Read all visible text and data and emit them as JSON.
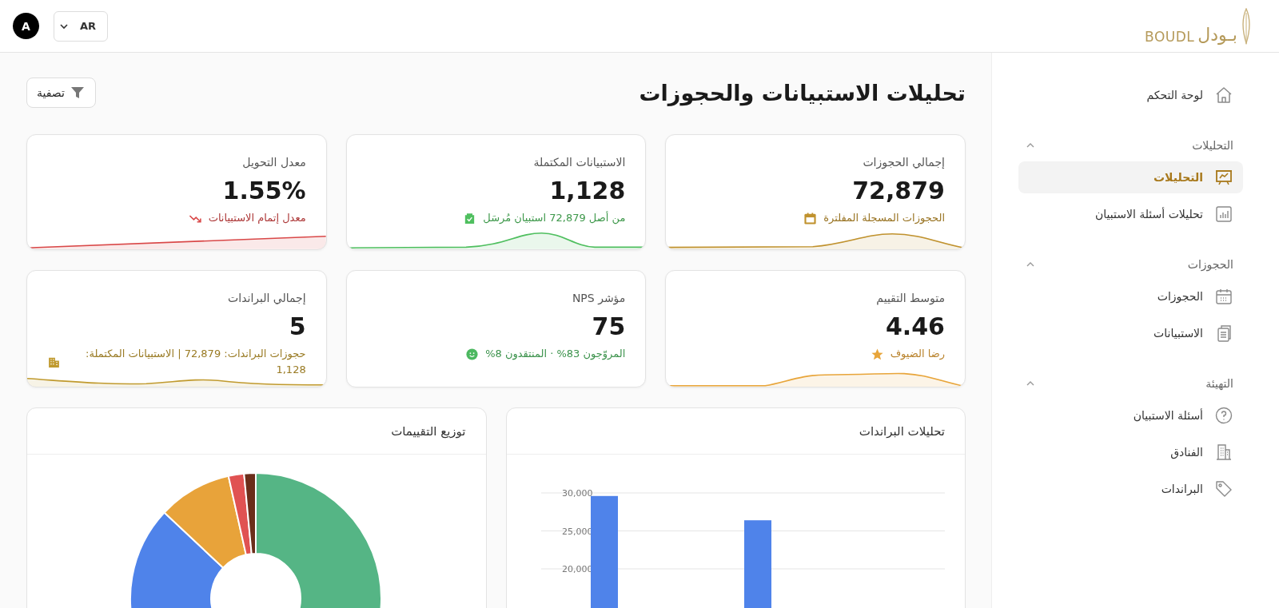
{
  "header": {
    "logo": {
      "latin": "BOUDL",
      "arabic": "بـودل"
    },
    "language": "AR",
    "avatar": "A"
  },
  "sidebar": {
    "items": [
      {
        "label": "لوحة التحكم",
        "selected": false
      }
    ],
    "sections": [
      {
        "title": "التحليلات",
        "expanded": true,
        "items": [
          {
            "label": "التحليلات",
            "selected": true
          },
          {
            "label": "تحليلات أسئلة الاستبيان",
            "selected": false
          }
        ]
      },
      {
        "title": "الحجوزات",
        "expanded": true,
        "items": [
          {
            "label": "الحجوزات",
            "selected": false
          },
          {
            "label": "الاستبيانات",
            "selected": false
          }
        ]
      },
      {
        "title": "التهيئة",
        "expanded": true,
        "items": [
          {
            "label": "أسئلة الاستبيان",
            "selected": false
          },
          {
            "label": "الفنادق",
            "selected": false
          },
          {
            "label": "البراندات",
            "selected": false
          }
        ]
      }
    ]
  },
  "page": {
    "title": "تحليلات الاستبيانات والحجوزات",
    "filter_button": "تصفية"
  },
  "cards": [
    {
      "title": "إجمالي الحجوزات",
      "value": "72,879",
      "subtitle": "الحجوزات المسجلة المفلترة",
      "color": "#c0922e"
    },
    {
      "title": "الاستبيانات المكتملة",
      "value": "1,128",
      "subtitle": "من أصل 72,879 استبيان مُرسَل",
      "color": "#4fbf5f"
    },
    {
      "title": "معدل التحويل",
      "value": "1.55%",
      "subtitle": "معدل إتمام الاستبيانات",
      "color": "#d94848"
    },
    {
      "title": "متوسط التقييم",
      "value": "4.46",
      "subtitle": "رضا الضيوف",
      "color": "#e8a53a"
    },
    {
      "title": "مؤشر NPS",
      "value": "75",
      "subtitle": "المروّجون 83% · المنتقدون 8%",
      "color": "#4cb860"
    },
    {
      "title": "إجمالي البراندات",
      "value": "5",
      "subtitle": "حجوزات البراندات: 72,879 | الاستبيانات المكتملة: 1,128",
      "color": "#c09a2e"
    }
  ],
  "panels": [
    {
      "title": "تحليلات البراندات",
      "chart_data": {
        "type": "bar",
        "ylim": [
          0,
          30000
        ],
        "values": [
          29600,
          26400
        ],
        "yticks": [
          {
            "value": 20000,
            "label": "20,000"
          },
          {
            "value": 25000,
            "label": "25,000"
          },
          {
            "value": 30000,
            "label": "30,000"
          }
        ]
      }
    },
    {
      "title": "توزيع التقييمات"
    }
  ]
}
